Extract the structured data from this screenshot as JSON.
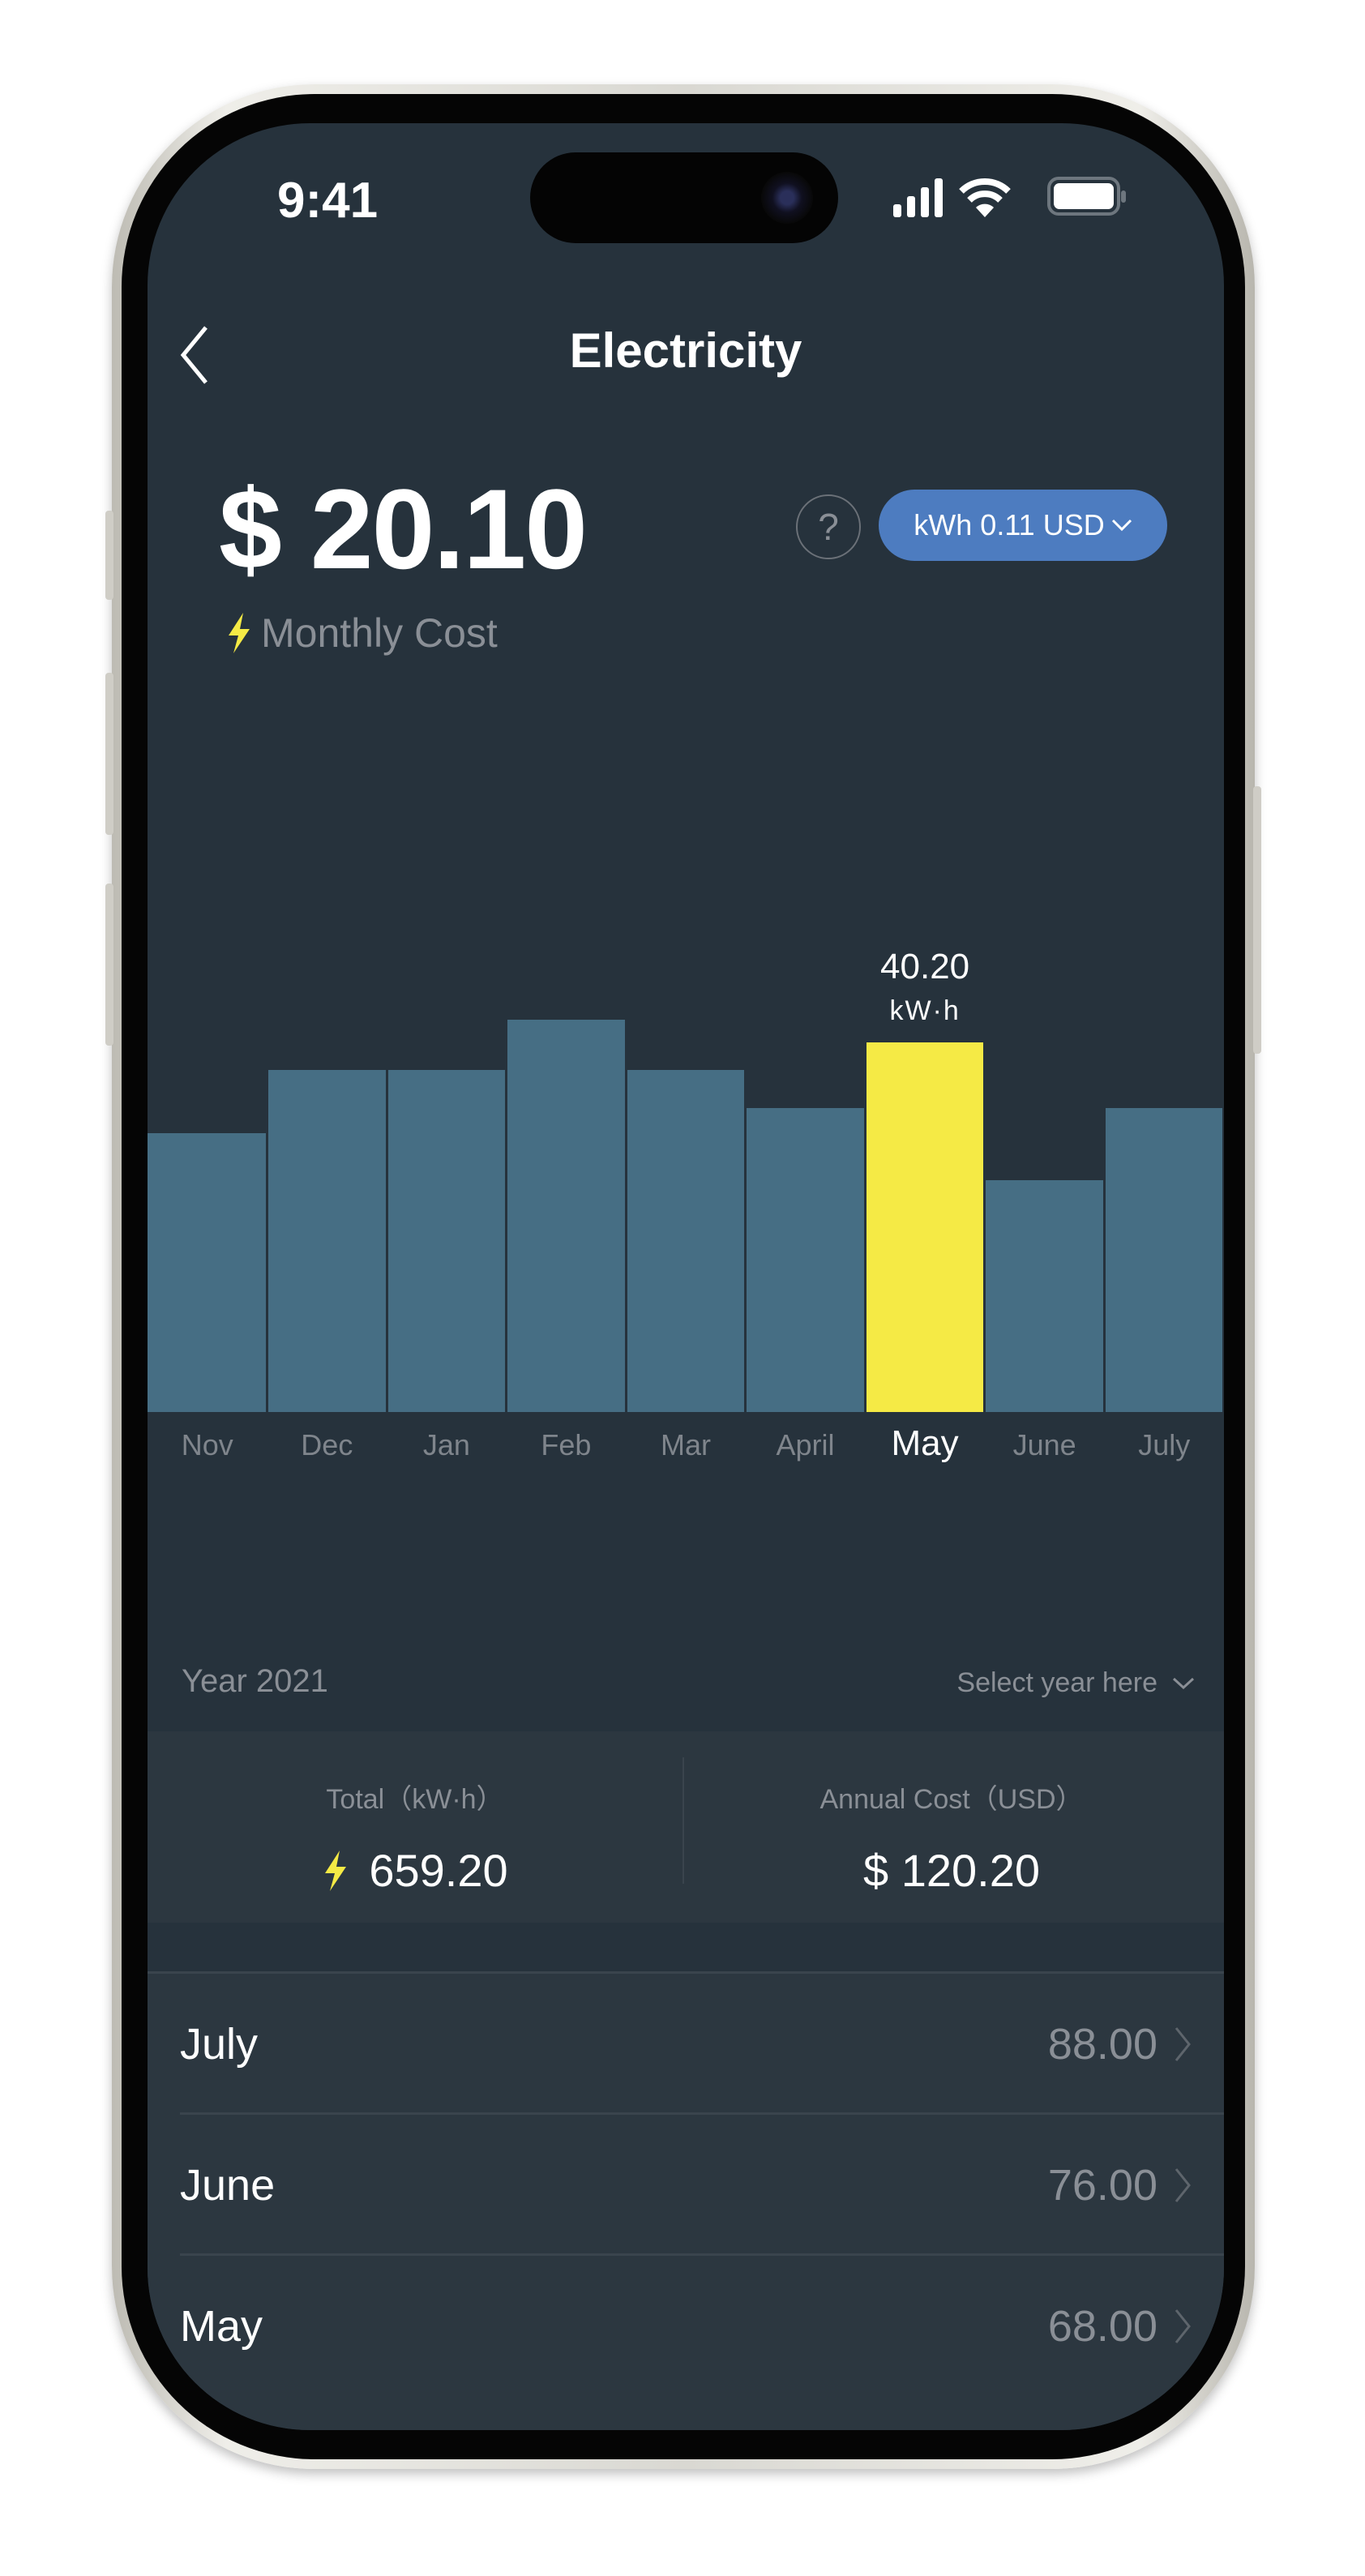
{
  "status_bar": {
    "time": "9:41",
    "icons": [
      "cellular-signal-icon",
      "wifi-icon",
      "battery-icon"
    ]
  },
  "header": {
    "title": "Electricity",
    "back_icon": "chevron-left-icon"
  },
  "summary_top": {
    "monthly_cost": "$ 20.10",
    "monthly_cost_label": "Monthly Cost",
    "rate_button": "kWh 0.11 USD",
    "help": "?"
  },
  "colors": {
    "background": "#26323c",
    "bar": "#466e84",
    "selected_bar": "#f5ea45",
    "accent": "#4d7cc0"
  },
  "chart_data": {
    "type": "bar",
    "categories": [
      "Nov",
      "Dec",
      "Jan",
      "Feb",
      "Mar",
      "April",
      "May",
      "June",
      "July"
    ],
    "values": [
      30.3,
      37.2,
      37.2,
      42.7,
      37.2,
      33.1,
      40.2,
      25.2,
      33.1
    ],
    "selected_index": 6,
    "selected_label": "40.20",
    "unit": "kW·h",
    "grid": false
  },
  "year_section": {
    "year_label": "Year 2021",
    "select_label": "Select year here"
  },
  "totals": {
    "total_label": "Total（kW·h）",
    "total_value": "659.20",
    "annual_label": "Annual Cost（USD）",
    "annual_value": "$ 120.20"
  },
  "months": [
    {
      "month": "July",
      "value": "88.00"
    },
    {
      "month": "June",
      "value": "76.00"
    },
    {
      "month": "May",
      "value": "68.00"
    }
  ]
}
